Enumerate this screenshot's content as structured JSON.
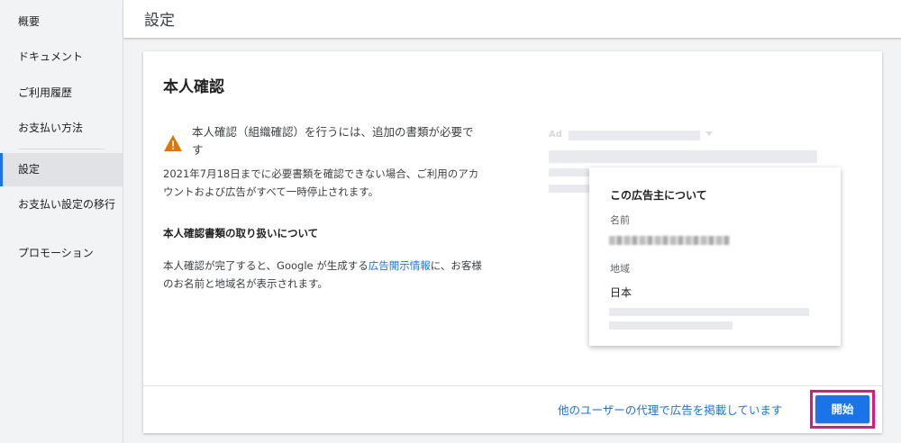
{
  "sidebar": {
    "items": [
      {
        "label": "概要"
      },
      {
        "label": "ドキュメント"
      },
      {
        "label": "ご利用履歴"
      },
      {
        "label": "お支払い方法"
      },
      {
        "label": "設定",
        "active": true
      },
      {
        "label": "お支払い設定の移行"
      },
      {
        "label": "プロモーション"
      }
    ]
  },
  "header": {
    "title": "設定"
  },
  "card": {
    "title": "本人確認",
    "warning": "本人確認（組織確認）を行うには、追加の書類が必要です",
    "description": "2021年7月18日までに必要書類を確認できない場合、ご利用のアカウントおよび広告がすべて一時停止されます。",
    "subheading": "本人確認書類の取り扱いについて",
    "paragraph_prefix": "本人確認が完了すると、Google が生成する",
    "paragraph_link": "広告開示情報",
    "paragraph_suffix": "に、お客様のお名前と地域名が表示されます。",
    "preview": {
      "ad_label": "Ad",
      "popup_title": "この広告主について",
      "name_label": "名前",
      "region_label": "地域",
      "region_value": "日本"
    },
    "agency_link": "他のユーザーの代理で広告を掲載しています",
    "start_button": "開始"
  },
  "colors": {
    "accent": "#1a73e8",
    "warning": "#e37400",
    "highlight": "#e0177f"
  },
  "icons": {
    "warning": "warning-triangle-icon"
  }
}
